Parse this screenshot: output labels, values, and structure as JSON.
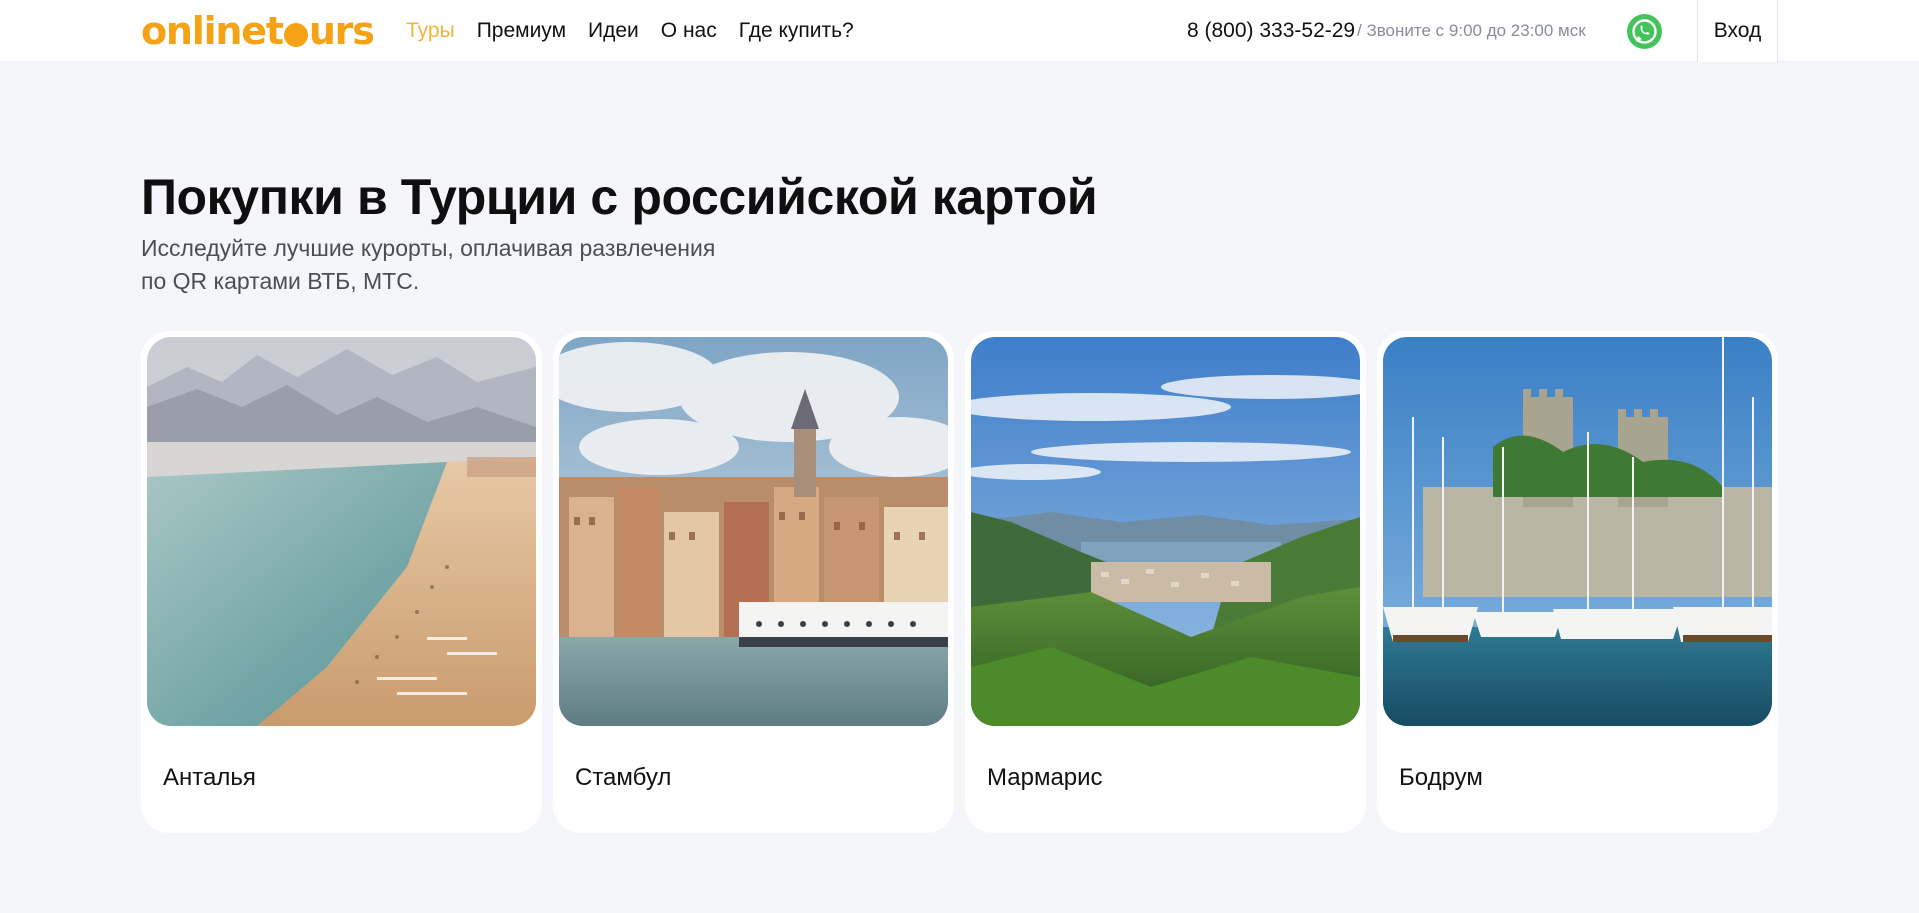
{
  "header": {
    "logo_text": "onlinetours",
    "nav": [
      {
        "label": "Туры",
        "active": true
      },
      {
        "label": "Премиум",
        "active": false
      },
      {
        "label": "Идеи",
        "active": false
      },
      {
        "label": "О нас",
        "active": false
      },
      {
        "label": "Где купить?",
        "active": false
      }
    ],
    "phone": "8 (800) 333-52-29",
    "hours": "/ Звоните с 9:00 до 23:00 мск",
    "whatsapp_icon": "whatsapp-icon",
    "login_label": "Вход"
  },
  "hero": {
    "title": "Покупки в Турции с российской картой",
    "subtitle_line1": "Исследуйте лучшие курорты, оплачивая развлечения",
    "subtitle_line2": "по QR картами ВТБ, МТС."
  },
  "cards": [
    {
      "label": "Анталья"
    },
    {
      "label": "Стамбул"
    },
    {
      "label": "Мармарис"
    },
    {
      "label": "Бодрум"
    }
  ],
  "colors": {
    "accent": "#f5a214",
    "nav_active": "#f2b43b",
    "background": "#f5f6fa",
    "whatsapp": "#43c45b"
  }
}
